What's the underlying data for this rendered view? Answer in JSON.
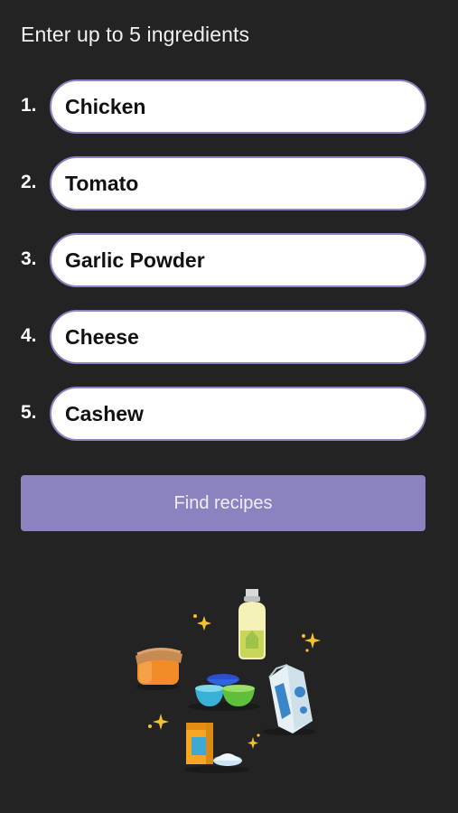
{
  "header": {
    "title": "Enter up to 5 ingredients"
  },
  "ingredients": [
    {
      "number": "1.",
      "value": "Chicken"
    },
    {
      "number": "2.",
      "value": "Tomato"
    },
    {
      "number": "3.",
      "value": "Garlic Powder"
    },
    {
      "number": "4.",
      "value": "Cheese"
    },
    {
      "number": "5.",
      "value": "Cashew"
    }
  ],
  "actions": {
    "find_label": "Find recipes"
  },
  "illustration": {
    "icon": "pantry-ingredients-illustration"
  },
  "colors": {
    "background": "#232323",
    "accent": "#8b83c0",
    "field_border": "#8b83c4"
  }
}
